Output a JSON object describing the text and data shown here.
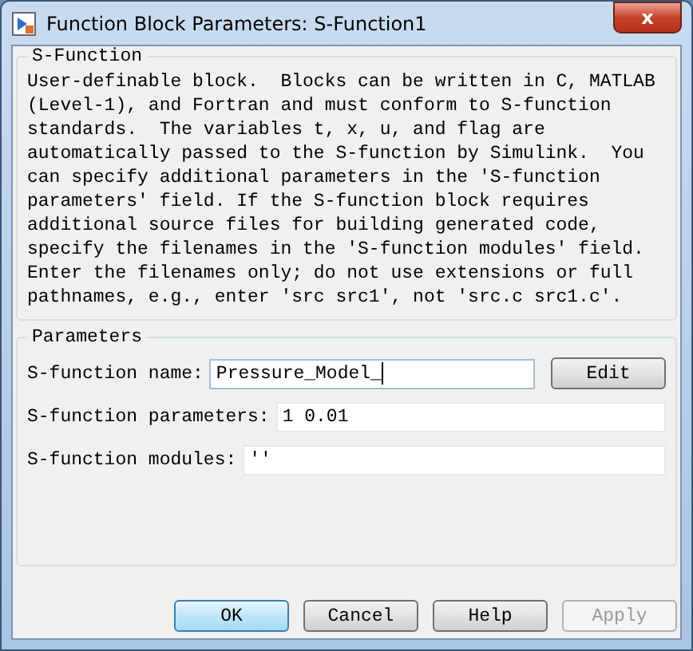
{
  "window": {
    "title": "Function Block Parameters: S-Function1",
    "close": "x"
  },
  "description_group": {
    "title": "S-Function",
    "text": "User-definable block.  Blocks can be written in C, MATLAB\n(Level-1), and Fortran and must conform to S-function\nstandards.  The variables t, x, u, and flag are\nautomatically passed to the S-function by Simulink.  You\ncan specify additional parameters in the 'S-function\nparameters' field. If the S-function block requires\nadditional source files for building generated code,\nspecify the filenames in the 'S-function modules' field.\nEnter the filenames only; do not use extensions or full\npathnames, e.g., enter 'src src1', not 'src.c src1.c'."
  },
  "parameters_group": {
    "title": "Parameters",
    "fields": [
      {
        "label": "S-function name:",
        "value": "Pressure_Model_",
        "focused": true,
        "button": "Edit"
      },
      {
        "label": "S-function parameters:",
        "value": "1 0.01",
        "focused": false
      },
      {
        "label": "S-function modules:",
        "value": "''",
        "focused": false
      }
    ]
  },
  "buttons": [
    {
      "label": "OK",
      "default": true,
      "disabled": false
    },
    {
      "label": "Cancel",
      "default": false,
      "disabled": false
    },
    {
      "label": "Help",
      "default": false,
      "disabled": false
    },
    {
      "label": "Apply",
      "default": false,
      "disabled": true
    }
  ]
}
